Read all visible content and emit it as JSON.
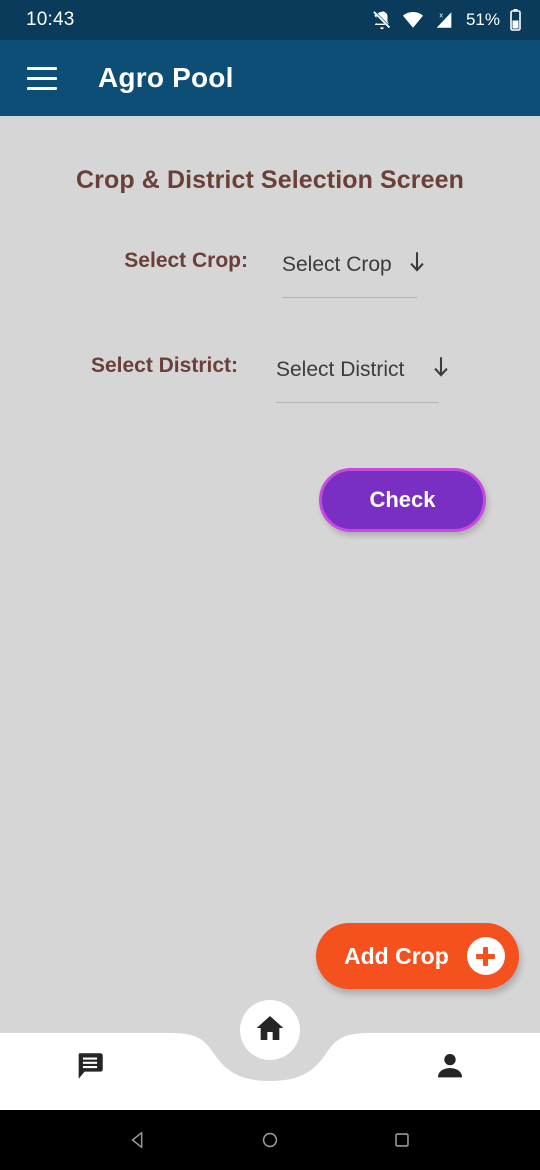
{
  "status_bar": {
    "time": "10:43",
    "battery_percent": "51%",
    "icons": [
      "notifications-off-icon",
      "wifi-icon",
      "cellular-no-sim-icon",
      "battery-icon"
    ]
  },
  "app_bar": {
    "menu_icon": "hamburger-menu-icon",
    "title": "Agro Pool"
  },
  "main": {
    "screen_title": "Crop & District Selection Screen",
    "fields": [
      {
        "label": "Select Crop:",
        "value": "Select Crop",
        "arrow_icon": "arrow-down-icon"
      },
      {
        "label": "Select District:",
        "value": "Select District",
        "arrow_icon": "arrow-down-icon"
      }
    ],
    "check_button": "Check",
    "add_crop_button": {
      "label": "Add Crop",
      "icon": "plus-icon"
    }
  },
  "bottom_nav": {
    "items": [
      {
        "name": "chat",
        "icon": "chat-bubble-icon"
      },
      {
        "name": "home",
        "icon": "home-icon"
      },
      {
        "name": "profile",
        "icon": "person-icon"
      }
    ]
  },
  "android_nav": {
    "back": "back-triangle-icon",
    "home": "home-circle-icon",
    "recents": "recents-square-icon"
  },
  "colors": {
    "status_bar": "#0a3b5a",
    "app_bar": "#0d4e76",
    "background": "#d6d6d6",
    "title_text": "#6b4038",
    "check_fill": "#7a2fc4",
    "check_border": "#c64ae0",
    "fab_orange": "#f4511e",
    "nav_bar": "#ffffff"
  }
}
